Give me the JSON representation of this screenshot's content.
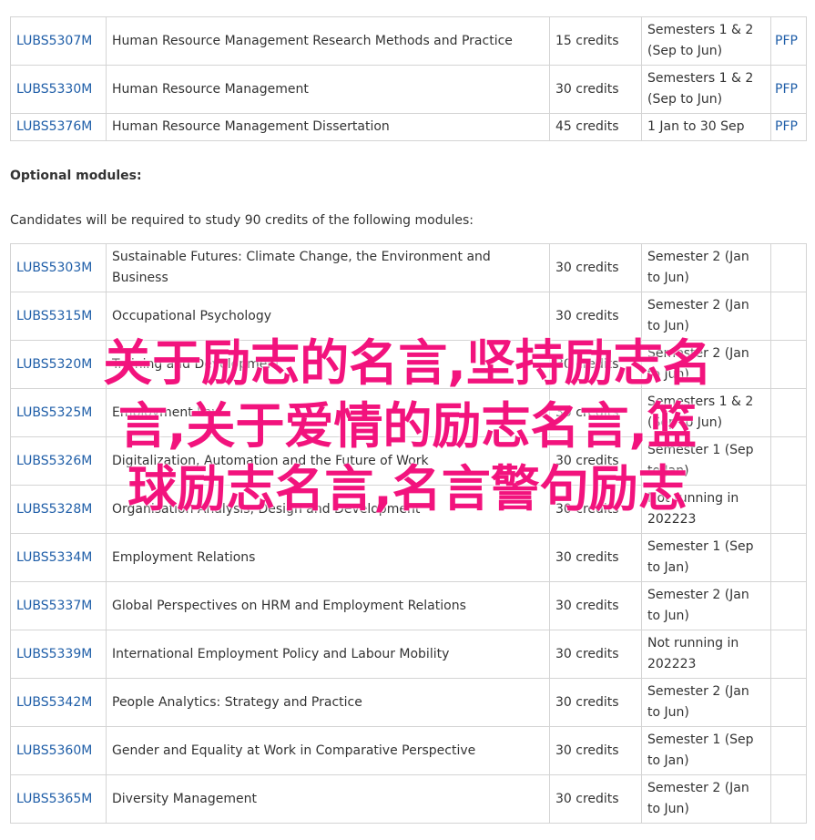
{
  "core_modules": [
    {
      "code": "LUBS5307M",
      "title": "Human Resource Management Research Methods and Practice",
      "credits": "15 credits",
      "period": "Semesters 1 & 2 (Sep to Jun)",
      "form": "PFP"
    },
    {
      "code": "LUBS5330M",
      "title": "Human Resource Management",
      "credits": "30 credits",
      "period": "Semesters 1 & 2 (Sep to Jun)",
      "form": "PFP"
    },
    {
      "code": "LUBS5376M",
      "title": "Human Resource Management Dissertation",
      "credits": "45 credits",
      "period": "1 Jan to 30 Sep",
      "form": "PFP"
    }
  ],
  "optional": {
    "heading": "Optional modules:",
    "intro": "Candidates will be required to study 90 credits of the following modules:"
  },
  "optional_modules": [
    {
      "code": "LUBS5303M",
      "title": "Sustainable Futures: Climate Change, the Environment and Business",
      "credits": "30 credits",
      "period": "Semester 2 (Jan to Jun)"
    },
    {
      "code": "LUBS5315M",
      "title": "Occupational Psychology",
      "credits": "30 credits",
      "period": "Semester 2 (Jan to Jun)"
    },
    {
      "code": "LUBS5320M",
      "title": "Training and Development",
      "credits": "30 credits",
      "period": "Semester 2 (Jan to Jun)"
    },
    {
      "code": "LUBS5325M",
      "title": "Employment Law",
      "credits": "30 credits",
      "period": "Semesters 1 & 2 (Sep to Jun)"
    },
    {
      "code": "LUBS5326M",
      "title": "Digitalization, Automation and the Future of Work",
      "credits": "30 credits",
      "period": "Semester 1 (Sep to Jan)"
    },
    {
      "code": "LUBS5328M",
      "title": "Organisation Analysis, Design and Development",
      "credits": "30 credits",
      "period": "Not running in 202223"
    },
    {
      "code": "LUBS5334M",
      "title": "Employment Relations",
      "credits": "30 credits",
      "period": "Semester 1 (Sep to Jan)"
    },
    {
      "code": "LUBS5337M",
      "title": "Global Perspectives on HRM and Employment Relations",
      "credits": "30 credits",
      "period": "Semester 2 (Jan to Jun)"
    },
    {
      "code": "LUBS5339M",
      "title": "International Employment Policy and Labour Mobility",
      "credits": "30 credits",
      "period": "Not running in 202223"
    },
    {
      "code": "LUBS5342M",
      "title": "People Analytics: Strategy and Practice",
      "credits": "30 credits",
      "period": "Semester 2 (Jan to Jun)"
    },
    {
      "code": "LUBS5360M",
      "title": "Gender and Equality at Work in Comparative Perspective",
      "credits": "30 credits",
      "period": "Semester 1 (Sep to Jan)"
    },
    {
      "code": "LUBS5365M",
      "title": "Diversity Management",
      "credits": "30 credits",
      "period": "Semester 2 (Jan to Jun)"
    }
  ],
  "watermark_lines": [
    "关于励志的名言,坚持励志名",
    "言,关于爱情的励志名言,篮",
    "球励志名言,名言警句励志"
  ],
  "colors": {
    "link": "#1f5ea8",
    "watermark": "#f2137d",
    "border": "#d4d4d4",
    "text": "#333333"
  }
}
